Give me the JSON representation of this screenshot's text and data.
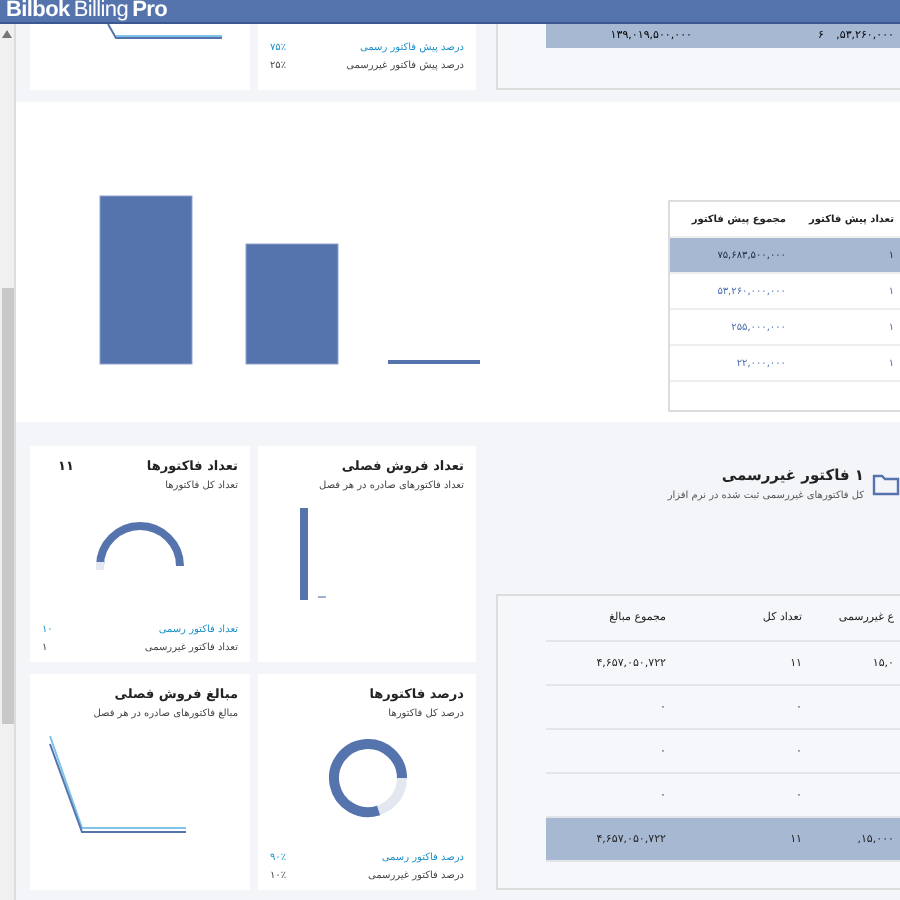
{
  "header": {
    "brand": "Bilbok",
    "product": "Billing",
    "edition": "Pro"
  },
  "top_legend": [
    {
      "label": "درصد پیش فاکتور رسمی",
      "value": "۷۵٪",
      "color": "#1a8fc6"
    },
    {
      "label": "درصد پیش فاکتور غیررسمی",
      "value": "۲۵٪",
      "color": "#444444"
    }
  ],
  "top_table": {
    "total_row": [
      "۵۳,۲۶۰,۰۰۰,",
      "۶",
      "۱۳۹,۰۱۹,۵۰۰,۰۰۰"
    ]
  },
  "proforma_table": {
    "columns": [
      "تعداد پیش فاکتور",
      "مجموع پیش فاکتور"
    ],
    "rows": [
      {
        "cells": [
          "۱",
          "۷۵,۶۸۳,۵۰۰,۰۰۰"
        ],
        "selected": true
      },
      {
        "cells": [
          "۱",
          "۵۳,۲۶۰,۰۰۰,۰۰۰"
        ],
        "selected": false
      },
      {
        "cells": [
          "۱",
          "۲۵۵,۰۰۰,۰۰۰"
        ],
        "selected": false
      },
      {
        "cells": [
          "۱",
          "۲۲,۰۰۰,۰۰۰"
        ],
        "selected": false
      }
    ]
  },
  "cards": [
    {
      "kind": "bars",
      "title": "تعداد فروش فصلی",
      "subtitle": "تعداد فاکتورهای صادره در هر فصل"
    },
    {
      "kind": "gauge",
      "title": "تعداد فاکتورها",
      "count": "۱۱",
      "subtitle": "تعداد کل فاکتورها",
      "legend": [
        {
          "label": "تعداد فاکتور رسمی",
          "value": "۱۰",
          "color": "#1a8fc6"
        },
        {
          "label": "تعداد فاکتور غیررسمی",
          "value": "۱",
          "color": "#444444"
        }
      ]
    },
    {
      "kind": "donut",
      "title": "درصد فاکتورها",
      "subtitle": "درصد کل فاکتورها",
      "legend": [
        {
          "label": "درصد فاکتور رسمی",
          "value": "۹۰٪",
          "color": "#1a8fc6"
        },
        {
          "label": "درصد فاکتور غیررسمی",
          "value": "۱۰٪",
          "color": "#444444"
        }
      ]
    },
    {
      "kind": "line",
      "title": "مبالغ فروش فصلی",
      "subtitle": "مبالغ فاکتورهای صادره در هر فصل"
    }
  ],
  "unofficial": {
    "title": "۱ فاکتور غیررسمی",
    "subtitle": "کل فاکتورهای غیررسمی ثبت شده در نرم افزار"
  },
  "summary_table": {
    "columns": [
      "ع غیررسمی",
      "تعداد کل",
      "مجموع مبالغ"
    ],
    "rows": [
      [
        "۱۵,۰",
        "۱۱",
        "۴,۶۵۷,۰۵۰,۷۲۲"
      ],
      [
        "",
        "۰",
        "۰"
      ],
      [
        "",
        "۰",
        "۰"
      ],
      [
        "",
        "۰",
        "۰"
      ]
    ],
    "total": [
      "۱۵,۰۰۰,",
      "۱۱",
      "۴,۶۵۷,۰۵۰,۷۲۲"
    ]
  }
}
